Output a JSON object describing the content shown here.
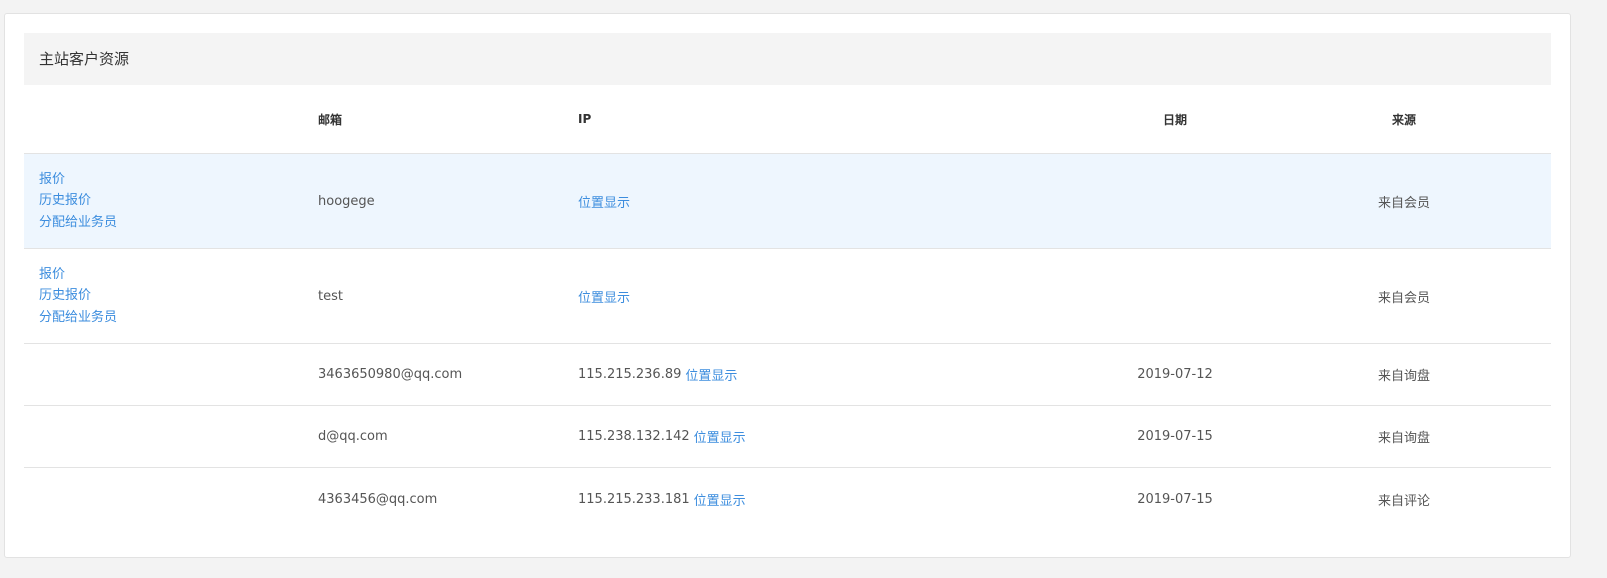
{
  "panel": {
    "title": "主站客户资源"
  },
  "table": {
    "headers": {
      "actions": "",
      "email": "邮箱",
      "ip": "IP",
      "date": "日期",
      "source": "来源"
    },
    "rows": [
      {
        "actions": [
          "报价",
          "历史报价",
          "分配给业务员"
        ],
        "email": "hoogege",
        "ip": "",
        "location_link": "位置显示",
        "date": "",
        "source": "来自会员"
      },
      {
        "actions": [
          "报价",
          "历史报价",
          "分配给业务员"
        ],
        "email": "test",
        "ip": "",
        "location_link": "位置显示",
        "date": "",
        "source": "来自会员"
      },
      {
        "actions": [],
        "email": "3463650980@qq.com",
        "ip": "115.215.236.89",
        "location_link": "位置显示",
        "date": "2019-07-12",
        "source": "来自询盘"
      },
      {
        "actions": [],
        "email": "d@qq.com",
        "ip": "115.238.132.142",
        "location_link": "位置显示",
        "date": "2019-07-15",
        "source": "来自询盘"
      },
      {
        "actions": [],
        "email": "4363456@qq.com",
        "ip": "115.215.233.181",
        "location_link": "位置显示",
        "date": "2019-07-15",
        "source": "来自评论"
      }
    ]
  },
  "colors": {
    "link": "#3c8dde",
    "highlight_row": "#eef6fe",
    "header_bg": "#f4f4f4"
  }
}
